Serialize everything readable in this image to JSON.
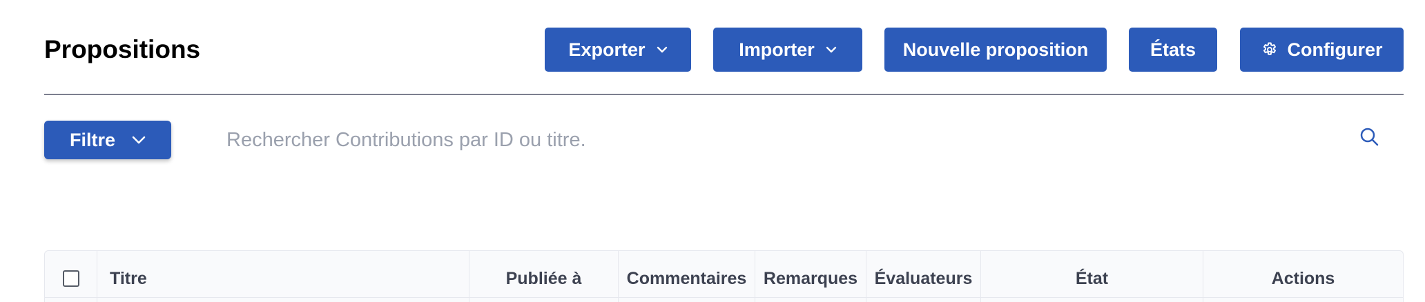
{
  "page": {
    "title": "Propositions"
  },
  "toolbar": {
    "export_label": "Exporter",
    "import_label": "Importer",
    "new_label": "Nouvelle proposition",
    "states_label": "États",
    "configure_label": "Configurer"
  },
  "filter": {
    "label": "Filtre"
  },
  "search": {
    "placeholder": "Rechercher Contributions par ID ou titre."
  },
  "table": {
    "columns": {
      "title": "Titre",
      "published": "Publiée à",
      "comments": "Commentaires",
      "remarks": "Remarques",
      "evaluators": "Évaluateurs",
      "state": "État",
      "actions": "Actions"
    }
  },
  "icons": [
    "chevron-down-icon",
    "gear-icon",
    "search-icon"
  ],
  "colors": {
    "primary": "#2c5bb9",
    "divider": "#7c7f8f",
    "placeholder": "#9aa0ad",
    "header_bg": "#f9fafc"
  }
}
